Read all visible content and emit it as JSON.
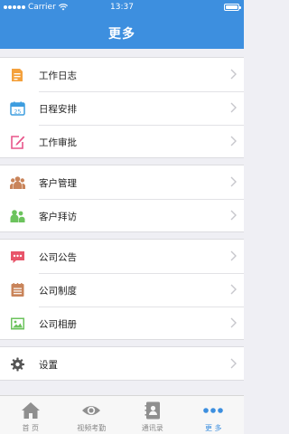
{
  "status_bar": {
    "carrier": "Carrier",
    "time": "13:37"
  },
  "header": {
    "title": "更多"
  },
  "groups": [
    {
      "items": [
        {
          "label": "工作日志",
          "icon": "work-log-icon",
          "color": "#f4a13d"
        },
        {
          "label": "日程安排",
          "icon": "calendar-icon",
          "color": "#3d9ddf",
          "icon_text": "25"
        },
        {
          "label": "工作审批",
          "icon": "approval-icon",
          "color": "#e8558a"
        }
      ]
    },
    {
      "items": [
        {
          "label": "客户管理",
          "icon": "customer-management-icon",
          "color": "#c9845a"
        },
        {
          "label": "客户拜访",
          "icon": "customer-visit-icon",
          "color": "#6cc35d"
        }
      ]
    },
    {
      "items": [
        {
          "label": "公司公告",
          "icon": "announcement-icon",
          "color": "#e8556a"
        },
        {
          "label": "公司制度",
          "icon": "regulations-icon",
          "color": "#c9845a"
        },
        {
          "label": "公司相册",
          "icon": "album-icon",
          "color": "#6cc35d"
        }
      ]
    },
    {
      "items": [
        {
          "label": "设置",
          "icon": "settings-icon",
          "color": "#555555"
        }
      ]
    }
  ],
  "tabbar": {
    "tabs": [
      {
        "label": "首 页",
        "icon": "home-icon",
        "active": false
      },
      {
        "label": "视频考勤",
        "icon": "eye-icon",
        "active": false
      },
      {
        "label": "通讯录",
        "icon": "contacts-icon",
        "active": false
      },
      {
        "label": "更 多",
        "icon": "more-icon",
        "active": true
      }
    ],
    "active_color": "#3d8fdf",
    "inactive_color": "#888888"
  },
  "colors": {
    "accent": "#3d8fdf",
    "background": "#efeff4"
  }
}
